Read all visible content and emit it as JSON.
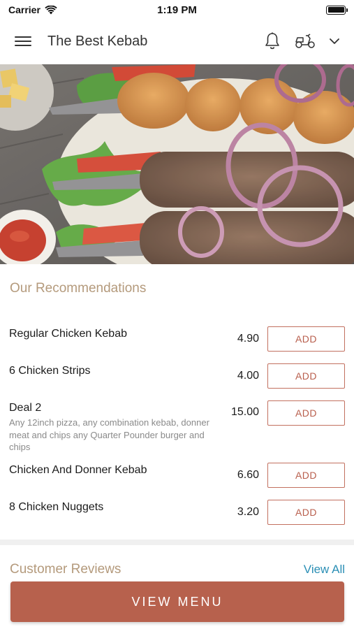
{
  "status_bar": {
    "carrier": "Carrier",
    "time": "1:19 PM"
  },
  "nav": {
    "title": "The Best Kebab",
    "icons": [
      "menu-icon",
      "bell-icon",
      "scooter-icon",
      "chevron-down-icon"
    ]
  },
  "recommendations": {
    "title": "Our Recommendations",
    "items": [
      {
        "name": "Regular Chicken Kebab",
        "description": "",
        "price": "4.90",
        "button": "ADD"
      },
      {
        "name": "6 Chicken Strips",
        "description": "",
        "price": "4.00",
        "button": "ADD"
      },
      {
        "name": "Deal 2",
        "description": "Any 12inch pizza, any combination kebab, donner meat and chips any Quarter Pounder burger and chips",
        "price": "15.00",
        "button": "ADD"
      },
      {
        "name": "Chicken And Donner Kebab",
        "description": "",
        "price": "6.60",
        "button": "ADD"
      },
      {
        "name": "8 Chicken Nuggets",
        "description": "",
        "price": "3.20",
        "button": "ADD"
      }
    ]
  },
  "reviews": {
    "title": "Customer Reviews",
    "view_all": "View All"
  },
  "footer": {
    "view_menu": "VIEW MENU"
  },
  "colors": {
    "accent": "#b7614d",
    "section_title": "#b49a7c",
    "link": "#2b8fb5"
  }
}
